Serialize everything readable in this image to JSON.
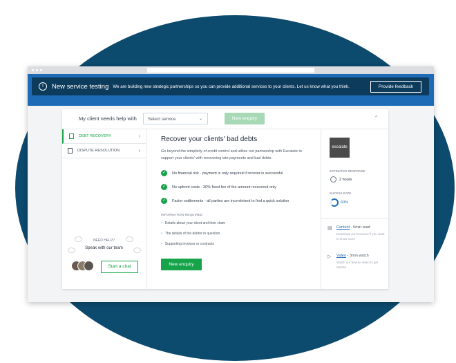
{
  "banner": {
    "title": "New service testing",
    "text": "We are building new strategic partnerships so you can provide additional services to your clients. Let us know what you think.",
    "button": "Provide feedback"
  },
  "topbar": {
    "label": "My client needs help with",
    "select_value": "Select service",
    "enquiry_button": "New enquiry"
  },
  "sidebar": {
    "items": [
      {
        "label": "DEBT RECOVERY",
        "active": true
      },
      {
        "label": "DISPUTE RESOLUTION",
        "active": false
      }
    ],
    "help": {
      "label": "NEED HELP?",
      "title": "Speak with our team",
      "chat_button": "Start a chat"
    }
  },
  "main": {
    "title": "Recover your clients' bad debts",
    "description": "Go beyond the simplicity of credit control and utilise our partnership with Escalate to support your clients' with recovering late payments and bad debts.",
    "benefits": [
      "No financial risk - payment is only required if recover is successful",
      "No upfront costs - 30% fixed fee of the amount recovered only",
      "Faster settlements - all parties are incentivised to find a quick solution"
    ],
    "info_heading": "INFORMATION REQUIRED",
    "info_items": [
      "Details about your client and their claim",
      "The details of the debtor in question",
      "Supporting invoices or contracts"
    ],
    "enquiry_button": "New enquiry"
  },
  "right": {
    "logo": "escalate",
    "response_label": "ESTIMATED RESPONSE",
    "response_value": "2 hours",
    "success_label": "SUCESS RATE",
    "success_value": "60%",
    "success_fraction": 0.6,
    "resources": [
      {
        "icon": "document-icon",
        "title": "Content",
        "meta": " - 5min read",
        "desc": "Download our brochure if you want to know more"
      },
      {
        "icon": "play-icon",
        "title": "Video",
        "meta": " - 3min watch",
        "desc": "Watch our feature video to get started"
      }
    ]
  },
  "colors": {
    "accent": "#16a34a",
    "brand": "#1d6bb6",
    "banner": "#0d3b5c",
    "backdrop": "#0c4a6e"
  }
}
